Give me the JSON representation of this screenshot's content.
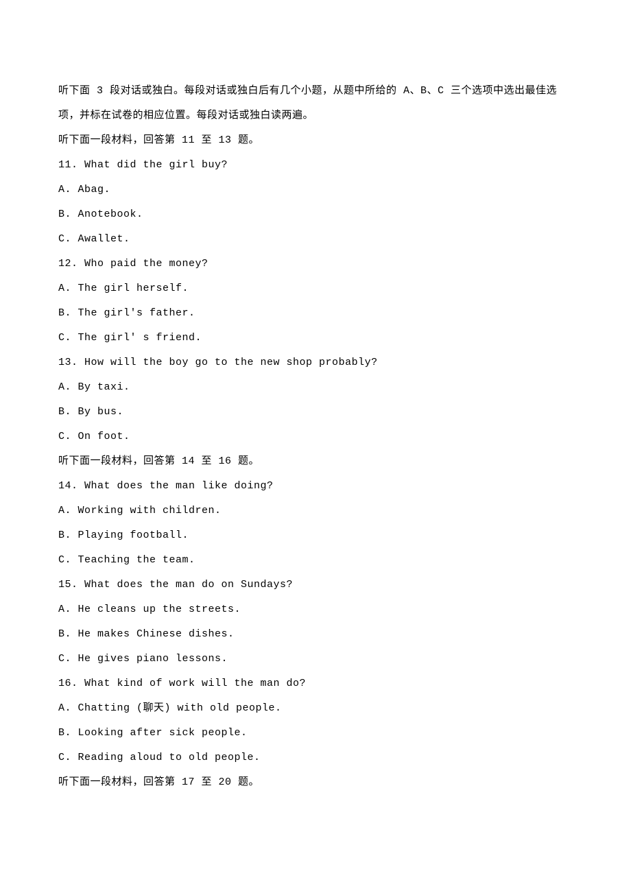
{
  "lines": [
    {
      "key": "l0",
      "text": "听下面 3 段对话或独白。每段对话或独白后有几个小题，从题中所给的 A、B、C 三个选项中选出最佳选"
    },
    {
      "key": "l1",
      "text": "项，并标在试卷的相应位置。每段对话或独白读两遍。"
    },
    {
      "key": "l2",
      "text": "听下面一段材料，回答第 11 至 13 题。"
    },
    {
      "key": "l3",
      "text": "11. What did the girl buy?"
    },
    {
      "key": "l4",
      "text": "A. Abag."
    },
    {
      "key": "l5",
      "text": "B. Anotebook."
    },
    {
      "key": "l6",
      "text": "C. Awallet."
    },
    {
      "key": "l7",
      "text": "12. Who paid the money?"
    },
    {
      "key": "l8",
      "text": "A. The girl herself."
    },
    {
      "key": "l9",
      "text": "B. The girl's father."
    },
    {
      "key": "l10",
      "text": "C. The girl' s friend."
    },
    {
      "key": "l11",
      "text": "13. How will the boy go to the new shop probably?"
    },
    {
      "key": "l12",
      "text": "A. By taxi."
    },
    {
      "key": "l13",
      "text": "B. By bus."
    },
    {
      "key": "l14",
      "text": "C. On foot."
    },
    {
      "key": "l15",
      "text": "听下面一段材料，回答第 14 至 16 题。"
    },
    {
      "key": "l16",
      "text": "14. What does the man like doing?"
    },
    {
      "key": "l17",
      "text": "A. Working with children."
    },
    {
      "key": "l18",
      "text": "B. Playing football."
    },
    {
      "key": "l19",
      "text": "C. Teaching the team."
    },
    {
      "key": "l20",
      "text": "15. What does the man do on Sundays?"
    },
    {
      "key": "l21",
      "text": "A. He cleans up the streets."
    },
    {
      "key": "l22",
      "text": "B. He makes Chinese dishes."
    },
    {
      "key": "l23",
      "text": "C. He gives piano lessons."
    },
    {
      "key": "l24",
      "text": "16. What kind of work will the man do?"
    },
    {
      "key": "l25",
      "text": "A. Chatting (聊天) with old people."
    },
    {
      "key": "l26",
      "text": "B. Looking after sick people."
    },
    {
      "key": "l27",
      "text": "C. Reading aloud to old people."
    },
    {
      "key": "l28",
      "text": "听下面一段材料，回答第 17 至 20 题。"
    }
  ]
}
